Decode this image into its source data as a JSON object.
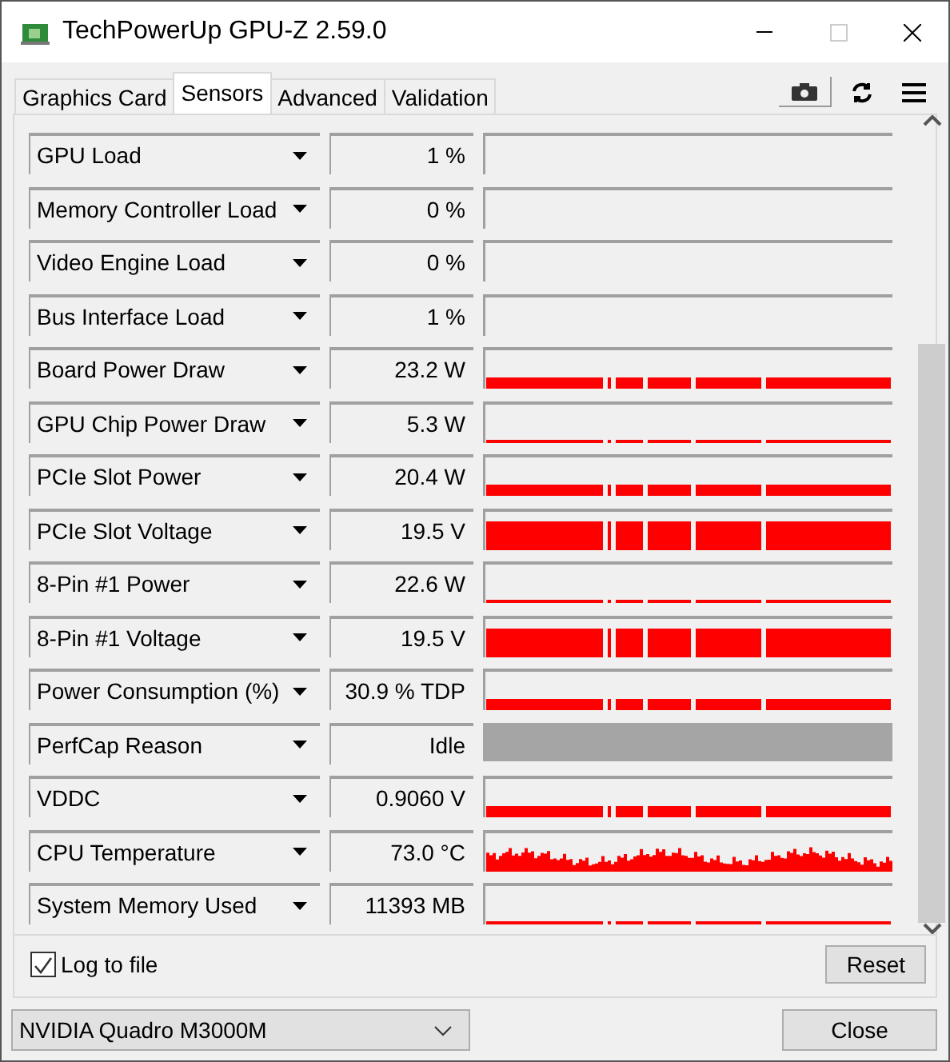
{
  "window": {
    "title": "TechPowerUp GPU-Z 2.59.0"
  },
  "tabs": [
    {
      "label": "Graphics Card",
      "selected": false
    },
    {
      "label": "Sensors",
      "selected": true
    },
    {
      "label": "Advanced",
      "selected": false
    },
    {
      "label": "Validation",
      "selected": false
    }
  ],
  "sensors": [
    {
      "name": "GPU Load",
      "value": "1 %",
      "kind": "empty"
    },
    {
      "name": "Memory Controller Load",
      "value": "0 %",
      "kind": "empty"
    },
    {
      "name": "Video Engine Load",
      "value": "0 %",
      "kind": "empty"
    },
    {
      "name": "Bus Interface Load",
      "value": "1 %",
      "kind": "empty"
    },
    {
      "name": "Board Power Draw",
      "value": "23.2 W",
      "kind": "low"
    },
    {
      "name": "GPU Chip Power Draw",
      "value": "5.3 W",
      "kind": "line"
    },
    {
      "name": "PCIe Slot Power",
      "value": "20.4 W",
      "kind": "low"
    },
    {
      "name": "PCIe Slot Voltage",
      "value": "19.5 V",
      "kind": "high"
    },
    {
      "name": "8-Pin #1 Power",
      "value": "22.6 W",
      "kind": "line"
    },
    {
      "name": "8-Pin #1 Voltage",
      "value": "19.5 V",
      "kind": "high"
    },
    {
      "name": "Power Consumption (%)",
      "value": "30.9 % TDP",
      "kind": "low"
    },
    {
      "name": "PerfCap Reason",
      "value": "Idle",
      "kind": "unavailable"
    },
    {
      "name": "VDDC",
      "value": "0.9060 V",
      "kind": "low"
    },
    {
      "name": "CPU Temperature",
      "value": "73.0 °C",
      "kind": "noisy"
    },
    {
      "name": "System Memory Used",
      "value": "11393 MB",
      "kind": "line"
    }
  ],
  "log_to_file": {
    "label": "Log to file",
    "checked": true
  },
  "reset_button": "Reset",
  "device_select": {
    "value": "NVIDIA Quadro M3000M"
  },
  "close_button": "Close"
}
